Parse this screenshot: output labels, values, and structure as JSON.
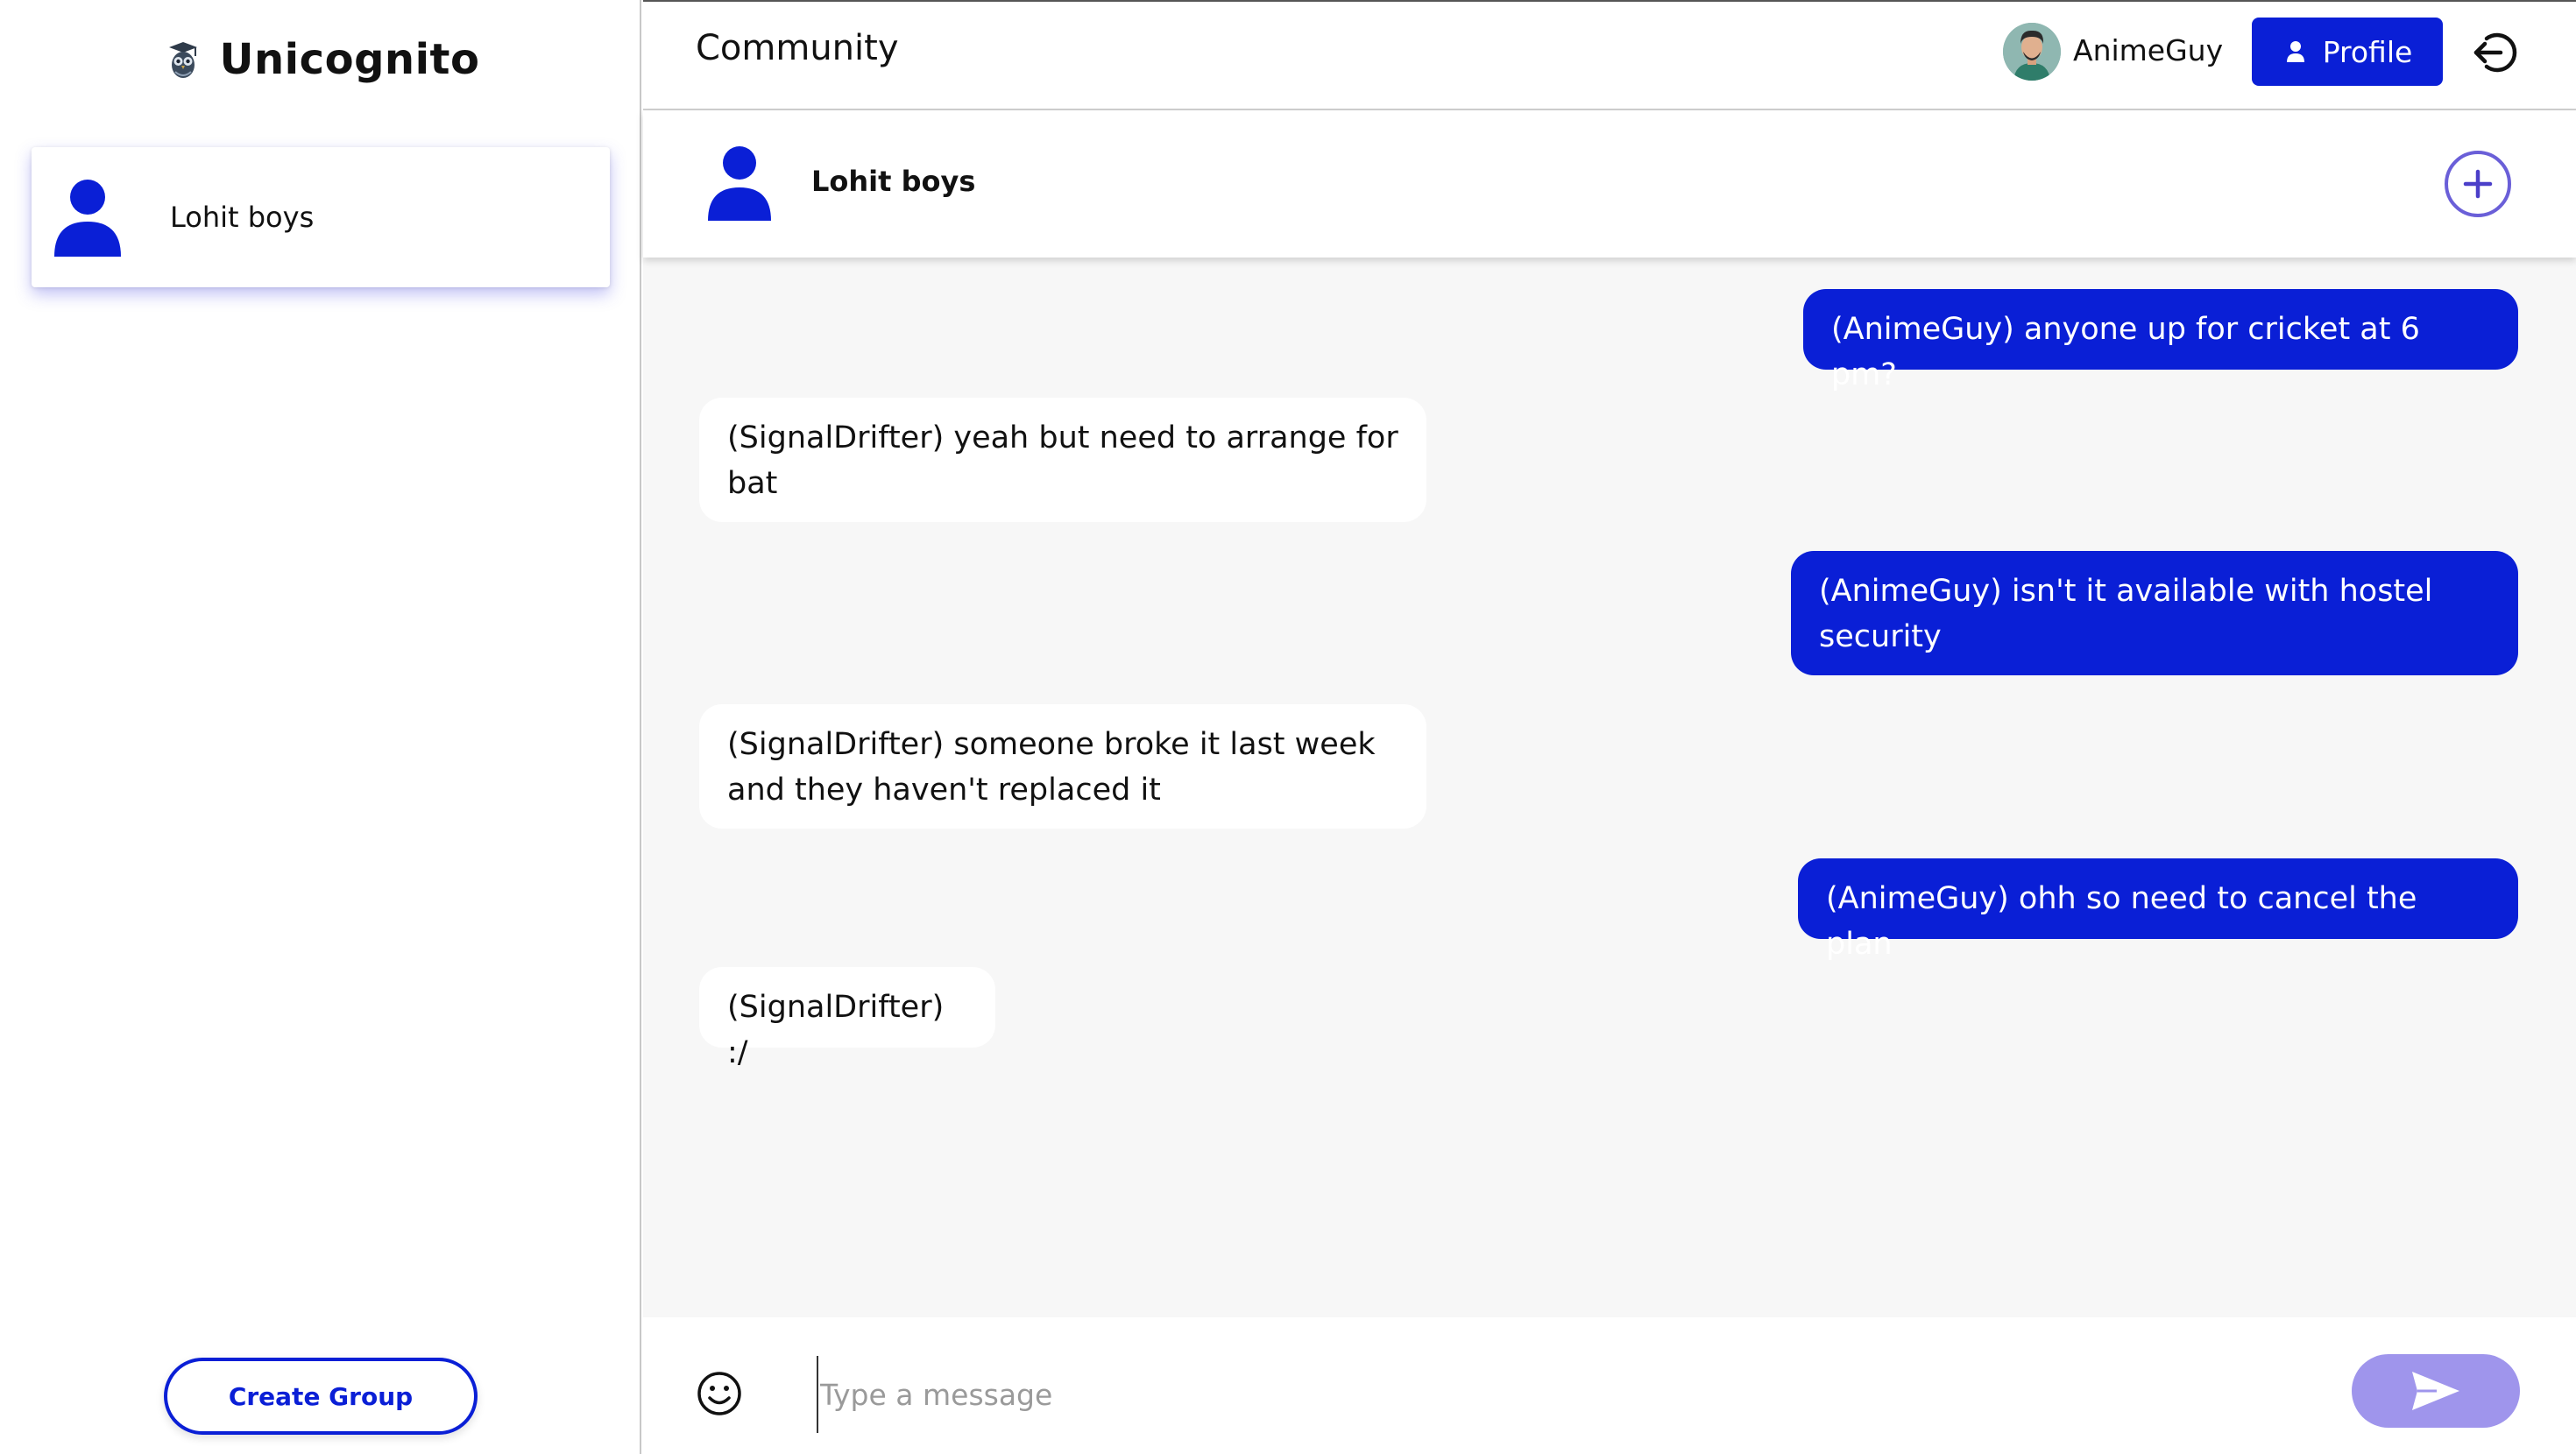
{
  "app": {
    "name": "Unicognito",
    "logo_icon": "owl-graduate-icon"
  },
  "sidebar": {
    "groups": [
      {
        "name": "Lohit boys",
        "icon": "person-icon"
      }
    ],
    "create_group_label": "Create Group"
  },
  "topbar": {
    "title": "Community",
    "user_name": "AnimeGuy",
    "profile_label": "Profile",
    "profile_icon": "person-icon",
    "logout_icon": "logout-icon"
  },
  "chat": {
    "name": "Lohit boys",
    "add_icon": "plus-circle-icon",
    "messages": [
      {
        "direction": "out",
        "text": "(AnimeGuy) anyone up for cricket at 6 pm?"
      },
      {
        "direction": "in",
        "text": "(SignalDrifter) yeah but need to arrange for bat"
      },
      {
        "direction": "out",
        "text": "(AnimeGuy) isn't it available with hostel security"
      },
      {
        "direction": "in",
        "text": "(SignalDrifter) someone broke it last week and they haven't replaced it"
      },
      {
        "direction": "out",
        "text": "(AnimeGuy) ohh so need to cancel the plan"
      },
      {
        "direction": "in",
        "text": "(SignalDrifter) :/"
      }
    ]
  },
  "composer": {
    "placeholder": "Type a message",
    "value": "",
    "emoji_icon": "smiley-icon",
    "send_icon": "send-icon"
  },
  "colors": {
    "accent": "#0a1fd6",
    "send_button": "#9f95ec",
    "chat_background": "#f7f7f7"
  }
}
